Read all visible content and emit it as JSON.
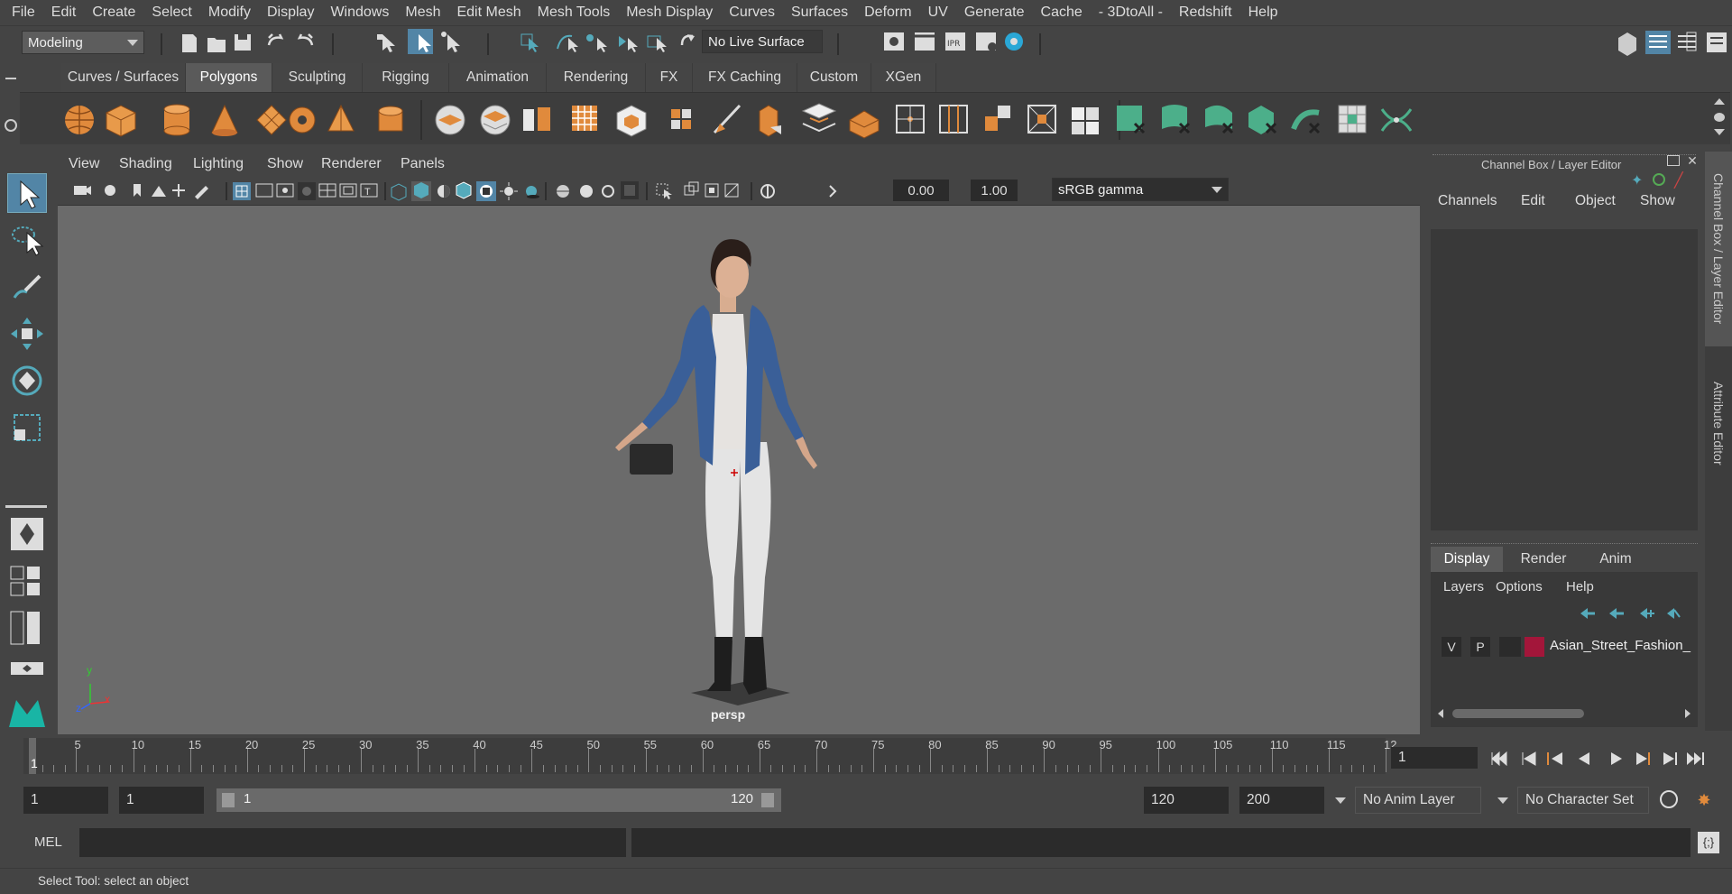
{
  "menubar": [
    "File",
    "Edit",
    "Create",
    "Select",
    "Modify",
    "Display",
    "Windows",
    "Mesh",
    "Edit Mesh",
    "Mesh Tools",
    "Mesh Display",
    "Curves",
    "Surfaces",
    "Deform",
    "UV",
    "Generate",
    "Cache",
    "- 3DtoAll -",
    "Redshift",
    "Help"
  ],
  "statusline": {
    "mode": "Modeling",
    "live_surface": "No Live Surface"
  },
  "shelf_tabs": [
    "Curves / Surfaces",
    "Polygons",
    "Sculpting",
    "Rigging",
    "Animation",
    "Rendering",
    "FX",
    "FX Caching",
    "Custom",
    "XGen"
  ],
  "shelf_active": "Polygons",
  "viewport": {
    "menus": [
      "View",
      "Shading",
      "Lighting",
      "Show",
      "Renderer",
      "Panels"
    ],
    "exposure": "0.00",
    "gamma": "1.00",
    "colorspace": "sRGB gamma",
    "camera_label": "persp",
    "axis_labels": {
      "y": "y",
      "z": "z",
      "x": "x"
    }
  },
  "channel_box": {
    "title": "Channel Box / Layer Editor",
    "menus": [
      "Channels",
      "Edit",
      "Object",
      "Show"
    ]
  },
  "layer_editor": {
    "tabs": [
      "Display",
      "Render",
      "Anim"
    ],
    "active_tab": "Display",
    "menus": [
      "Layers",
      "Options",
      "Help"
    ],
    "layers": [
      {
        "v": "V",
        "p": "P",
        "color": "#a3163a",
        "name": "Asian_Street_Fashion_"
      }
    ]
  },
  "side_tabs": [
    "Channel Box / Layer Editor",
    "Attribute Editor"
  ],
  "timeline": {
    "ticks": [
      "5",
      "10",
      "15",
      "20",
      "25",
      "30",
      "35",
      "40",
      "45",
      "50",
      "55",
      "60",
      "65",
      "70",
      "75",
      "80",
      "85",
      "90",
      "95",
      "100",
      "105",
      "110",
      "115",
      "12"
    ],
    "current_frame_marker": "1",
    "current_frame_field": "1"
  },
  "range": {
    "start": "1",
    "playback_start": "1",
    "slider_start": "1",
    "slider_end": "120",
    "playback_end": "120",
    "end": "200",
    "anim_layer": "No Anim Layer",
    "character_set": "No Character Set"
  },
  "cmdline": {
    "label": "MEL"
  },
  "helpline": {
    "text": "Select Tool: select an object"
  }
}
